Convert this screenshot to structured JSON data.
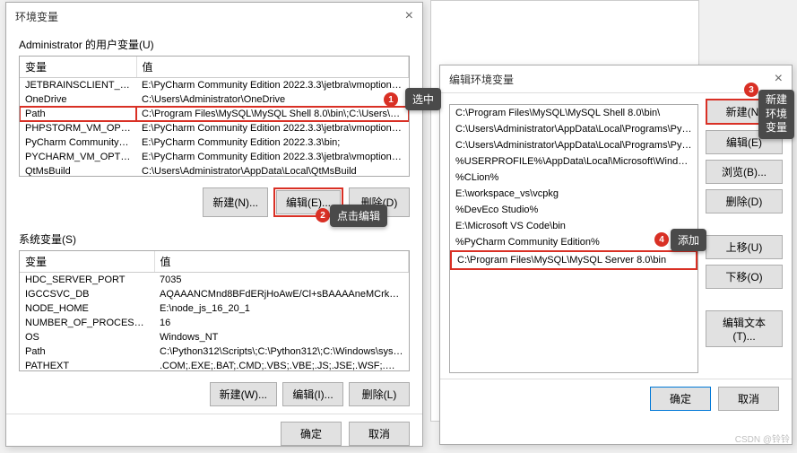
{
  "bg_placeholder": "",
  "main_dialog": {
    "title": "环境变量",
    "user_section_label": "Administrator 的用户变量(U)",
    "headers": {
      "var": "变量",
      "val": "值"
    },
    "user_rows": [
      {
        "var": "JETBRAINSCLIENT_VM_O...",
        "val": "E:\\PyCharm Community Edition 2022.3.3\\jetbra\\vmoptions\\jet..."
      },
      {
        "var": "OneDrive",
        "val": "C:\\Users\\Administrator\\OneDrive"
      },
      {
        "var": "Path",
        "val": "C:\\Program Files\\MySQL\\MySQL Shell 8.0\\bin\\;C:\\Users\\Admi...",
        "selected": true
      },
      {
        "var": "PHPSTORM_VM_OPTIONS",
        "val": "E:\\PyCharm Community Edition 2022.3.3\\jetbra\\vmoptions\\ph..."
      },
      {
        "var": "PyCharm Community Editi...",
        "val": "E:\\PyCharm Community Edition 2022.3.3\\bin;"
      },
      {
        "var": "PYCHARM_VM_OPTIONS",
        "val": "E:\\PyCharm Community Edition 2022.3.3\\jetbra\\vmoptions\\py..."
      },
      {
        "var": "QtMsBuild",
        "val": "C:\\Users\\Administrator\\AppData\\Local\\QtMsBuild"
      }
    ],
    "sys_section_label": "系统变量(S)",
    "sys_rows": [
      {
        "var": "HDC_SERVER_PORT",
        "val": "7035"
      },
      {
        "var": "IGCCSVC_DB",
        "val": "AQAAANCMnd8BFdERjHoAwE/Cl+sBAAAAneMCrkdqekmEvG..."
      },
      {
        "var": "NODE_HOME",
        "val": "E:\\node_js_16_20_1"
      },
      {
        "var": "NUMBER_OF_PROCESSORS",
        "val": "16"
      },
      {
        "var": "OS",
        "val": "Windows_NT"
      },
      {
        "var": "Path",
        "val": "C:\\Python312\\Scripts\\;C:\\Python312\\;C:\\Windows\\system32;C:..."
      },
      {
        "var": "PATHEXT",
        "val": ".COM;.EXE;.BAT;.CMD;.VBS;.VBE;.JS;.JSE;.WSF;.WSH;.MSC;.PY;.P..."
      }
    ],
    "btn_new": "新建(N)...",
    "btn_edit": "编辑(E)...",
    "btn_delete": "删除(D)",
    "btn_new_w": "新建(W)...",
    "btn_edit_i": "编辑(I)...",
    "btn_delete_l": "删除(L)",
    "btn_ok": "确定",
    "btn_cancel": "取消"
  },
  "edit_dialog": {
    "title": "编辑环境变量",
    "paths": [
      "C:\\Program Files\\MySQL\\MySQL Shell 8.0\\bin\\",
      "C:\\Users\\Administrator\\AppData\\Local\\Programs\\Python\\Pytho...",
      "C:\\Users\\Administrator\\AppData\\Local\\Programs\\Python\\Pytho...",
      "%USERPROFILE%\\AppData\\Local\\Microsoft\\WindowsApps",
      "%CLion%",
      "E:\\workspace_vs\\vcpkg",
      "%DevEco Studio%",
      "E:\\Microsoft VS Code\\bin",
      "%PyCharm Community Edition%",
      "C:\\Program Files\\MySQL\\MySQL Server 8.0\\bin"
    ],
    "highlighted_index": 9,
    "btn_new": "新建(N)",
    "btn_edit": "编辑(E)",
    "btn_browse": "浏览(B)...",
    "btn_delete": "删除(D)",
    "btn_up": "上移(U)",
    "btn_down": "下移(O)",
    "btn_edit_text": "编辑文本(T)...",
    "btn_ok": "确定",
    "btn_cancel": "取消"
  },
  "annotations": {
    "b1": "选中",
    "b2": "点击编辑",
    "b3": "新建\n环境\n变量",
    "b4": "添加",
    "n1": "1",
    "n2": "2",
    "n3": "3",
    "n4": "4"
  },
  "watermark": "CSDN @铃铃"
}
